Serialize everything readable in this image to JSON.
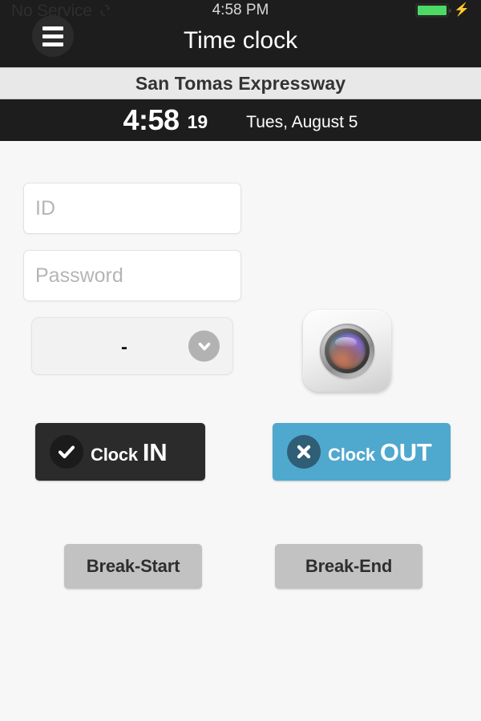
{
  "status_bar": {
    "carrier": "No Service",
    "sync_icon": "sync-icon",
    "time": "4:58 PM",
    "battery_icon": "battery-full-icon",
    "charging_icon": "lightning-bolt-icon"
  },
  "nav_bar": {
    "menu_icon": "hamburger-menu-icon",
    "title": "Time clock"
  },
  "location": {
    "name": "San Tomas Expressway"
  },
  "clock": {
    "time": "4:58",
    "seconds": "19",
    "date": "Tues, August 5"
  },
  "form": {
    "id_placeholder": "ID",
    "password_placeholder": "Password",
    "select_value": "-",
    "select_chevron_icon": "chevron-down-icon"
  },
  "camera": {
    "icon": "camera-lens-icon"
  },
  "actions": {
    "clock_in": {
      "icon": "checkmark-icon",
      "label_small": "Clock",
      "label_large": "IN",
      "color": "#2b2b2b"
    },
    "clock_out": {
      "icon": "cross-x-icon",
      "label_small": "Clock",
      "label_large": "OUT",
      "color": "#4fa8ce"
    },
    "break_start": "Break-Start",
    "break_end": "Break-End"
  }
}
